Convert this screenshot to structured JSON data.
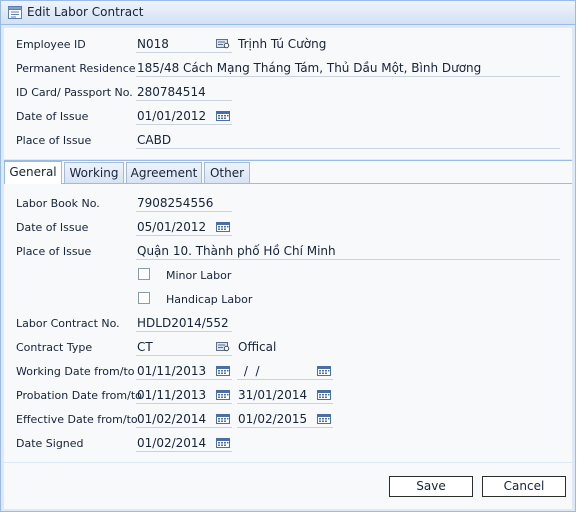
{
  "window": {
    "title": "Edit Labor Contract",
    "icon": "edit-form-icon"
  },
  "header": {
    "employee_id_label": "Employee ID",
    "employee_id": "N018",
    "employee_name": "Trịnh Tú Cường",
    "permanent_residence_label": "Permanent Residence",
    "permanent_residence": "185/48 Cách Mạng Tháng Tám, Thủ Dầu Một, Bình Dương",
    "id_card_label": "ID Card/ Passport No.",
    "id_card": "280784514",
    "date_of_issue_label": "Date of Issue",
    "date_of_issue": "01/01/2012",
    "place_of_issue_label": "Place of Issue",
    "place_of_issue": "CABD"
  },
  "tabs": [
    {
      "label": "General",
      "active": true
    },
    {
      "label": "Working",
      "active": false
    },
    {
      "label": "Agreement",
      "active": false
    },
    {
      "label": "Other",
      "active": false
    }
  ],
  "general": {
    "labor_book_label": "Labor Book No.",
    "labor_book": "7908254556",
    "date_of_issue_label": "Date of Issue",
    "date_of_issue": "05/01/2012",
    "place_of_issue_label": "Place of Issue",
    "place_of_issue": "Quận 10. Thành phố Hồ Chí Minh",
    "minor_labor_label": "Minor Labor",
    "minor_labor_checked": false,
    "handicap_labor_label": "Handicap Labor",
    "handicap_labor_checked": false,
    "contract_no_label": "Labor Contract No.",
    "contract_no": "HDLD2014/552",
    "contract_type_label": "Contract Type",
    "contract_type": "CT",
    "contract_type_name": "Offical",
    "working_date_label": "Working Date from/to",
    "working_date_from": "01/11/2013",
    "working_date_to": " /  /",
    "probation_date_label": "Probation Date from/to",
    "probation_date_from": "01/11/2013",
    "probation_date_to": "31/01/2014",
    "effective_date_label": "Effective Date from/to",
    "effective_date_from": "01/02/2014",
    "effective_date_to": "01/02/2015",
    "date_signed_label": "Date Signed",
    "date_signed": "01/02/2014"
  },
  "footer": {
    "save_label": "Save",
    "cancel_label": "Cancel"
  },
  "colors": {
    "frame": "#99bbe8",
    "panel": "#f8f9fa",
    "text": "#15233b"
  }
}
